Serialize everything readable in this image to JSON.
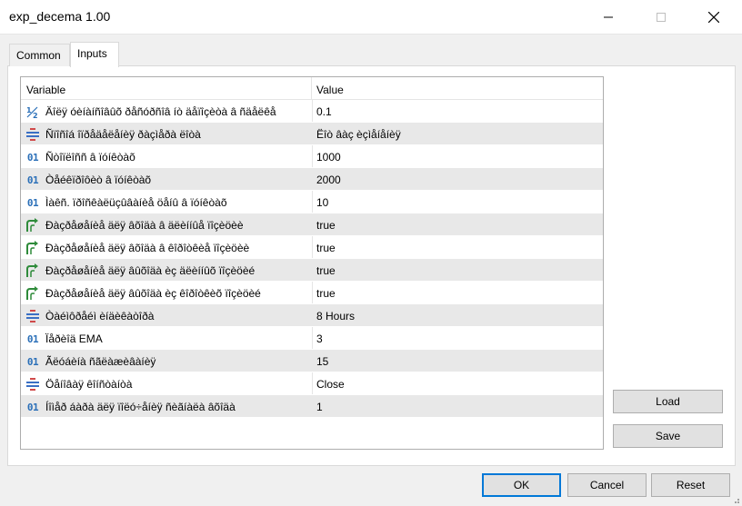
{
  "window": {
    "title": "exp_decema 1.00"
  },
  "tabs": [
    {
      "label": "Common",
      "active": false
    },
    {
      "label": "Inputs",
      "active": true
    }
  ],
  "grid": {
    "headers": {
      "variable": "Variable",
      "value": "Value"
    },
    "rows": [
      {
        "icon": "fraction-icon",
        "name": "Äîëÿ óèíàíñîâûõ ðåñóðñîâ íò äåïîçèòà â ñäåëêå",
        "value": "0.1"
      },
      {
        "icon": "enum-icon",
        "name": "Ñïîñîá îïðåäåëåíèÿ ðàçìåðà ëîòà",
        "value": "Ëîò âàç èçìåíåíèÿ"
      },
      {
        "icon": "int-icon",
        "name": "Ñòîïëîññ â ïóíêòàõ",
        "value": "1000"
      },
      {
        "icon": "int-icon",
        "name": "Òåéêïðîôèò â ïóíêòàõ",
        "value": "2000"
      },
      {
        "icon": "int-icon",
        "name": "Ìàêñ. ïðîñêàëüçûâàíèå öåíû â ïóíêòàõ",
        "value": "10"
      },
      {
        "icon": "bool-icon",
        "name": "Ðàçðåøåíèå äëÿ âõîäà â äëèííûå ïîçèöèè",
        "value": "true"
      },
      {
        "icon": "bool-icon",
        "name": "Ðàçðåøåíèå äëÿ âõîäà â êîðîòêèå ïîçèöèè",
        "value": "true"
      },
      {
        "icon": "bool-icon",
        "name": "Ðàçðåøåíèå äëÿ âûõîäà èç äëèííûõ ïîçèöèé",
        "value": "true"
      },
      {
        "icon": "bool-icon",
        "name": "Ðàçðåøåíèå äëÿ âûõîäà èç êîðîòêèõ ïîçèöèé",
        "value": "true"
      },
      {
        "icon": "enum-icon",
        "name": "Òàéìôðåéì èíäèêàòîðà",
        "value": "8 Hours"
      },
      {
        "icon": "int-icon",
        "name": "Ïåðèîä EMA",
        "value": "3"
      },
      {
        "icon": "int-icon",
        "name": "Ãëóáèíà ñãëàæèâàíèÿ",
        "value": "15"
      },
      {
        "icon": "enum-icon",
        "name": "Öåíîâàÿ êîíñòàíòà",
        "value": "Close"
      },
      {
        "icon": "int-icon",
        "name": "Íîìåð áàðà äëÿ ïîëó÷åíèÿ ñèãíàëà âõîäà",
        "value": "1"
      }
    ]
  },
  "side_buttons": {
    "load": "Load",
    "save": "Save"
  },
  "footer_buttons": {
    "ok": "OK",
    "cancel": "Cancel",
    "reset": "Reset"
  },
  "icon_glyphs": {
    "int-icon": "01"
  },
  "colors": {
    "accent": "#0078d7",
    "int_icon": "#2a6fb8",
    "bool_icon": "#2e8b3a",
    "enum_icon_red": "#d04a4a",
    "enum_icon_blue": "#3a6fc4",
    "alt_row": "#e8e8e8"
  }
}
